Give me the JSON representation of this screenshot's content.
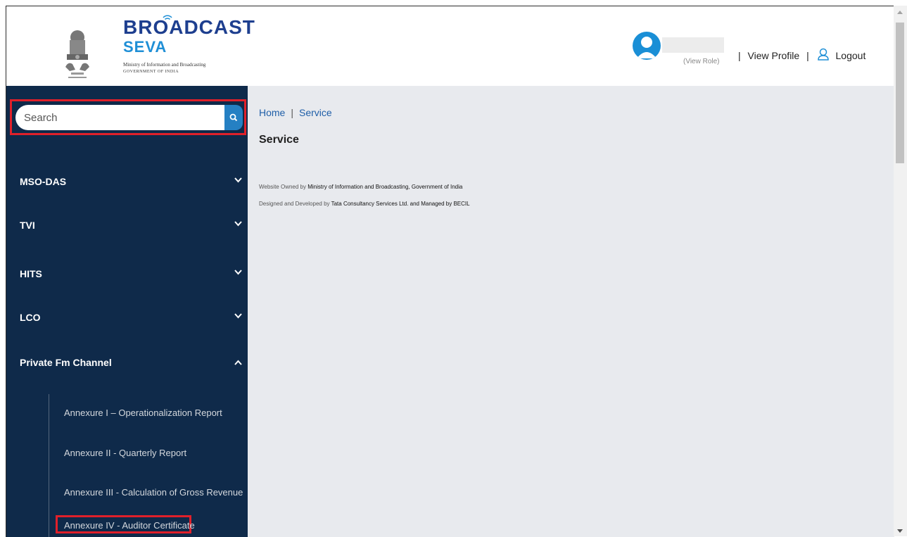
{
  "header": {
    "brand_title": "BROADCAST",
    "brand_sub": "SEVA",
    "ministry": "Ministry of Information and Broadcasting",
    "government": "GOVERNMENT OF INDIA",
    "view_role": "(View Role)",
    "view_profile": "View Profile",
    "logout": "Logout",
    "separator": "|"
  },
  "search": {
    "placeholder": "Search",
    "icon": "search-icon"
  },
  "sidebar": {
    "items": [
      {
        "label": "MSO-DAS",
        "icon": "chevron-down-icon"
      },
      {
        "label": "TVI",
        "icon": "chevron-down-icon"
      },
      {
        "label": "HITS",
        "icon": "chevron-down-icon"
      },
      {
        "label": "LCO",
        "icon": "chevron-down-icon"
      },
      {
        "label": "Private Fm Channel",
        "icon": "chevron-up-icon"
      }
    ],
    "sub_items": [
      {
        "label": "Annexure I – Operationalization Report"
      },
      {
        "label": "Annexure II - Quarterly Report"
      },
      {
        "label": "Annexure III - Calculation of Gross Revenue"
      },
      {
        "label": "Annexure IV - Auditor Certificate"
      }
    ]
  },
  "main": {
    "breadcrumb": {
      "home": "Home",
      "sep": "|",
      "current": "Service"
    },
    "title": "Service",
    "footer_line1_prefix": "Website Owned by ",
    "footer_line1_link": "Ministry of Information and Broadcasting, Government of India",
    "footer_line2_prefix": "Designed and Developed by ",
    "footer_line2_link": "Tata Consultancy Services Ltd. and Managed by BECIL"
  },
  "colors": {
    "sidebar_bg": "#0f2a4a",
    "main_bg": "#e8eaee",
    "highlight": "#e0202a",
    "accent": "#2580c3",
    "brand_dark": "#1e3f8f",
    "brand_light": "#1f8fd6"
  }
}
